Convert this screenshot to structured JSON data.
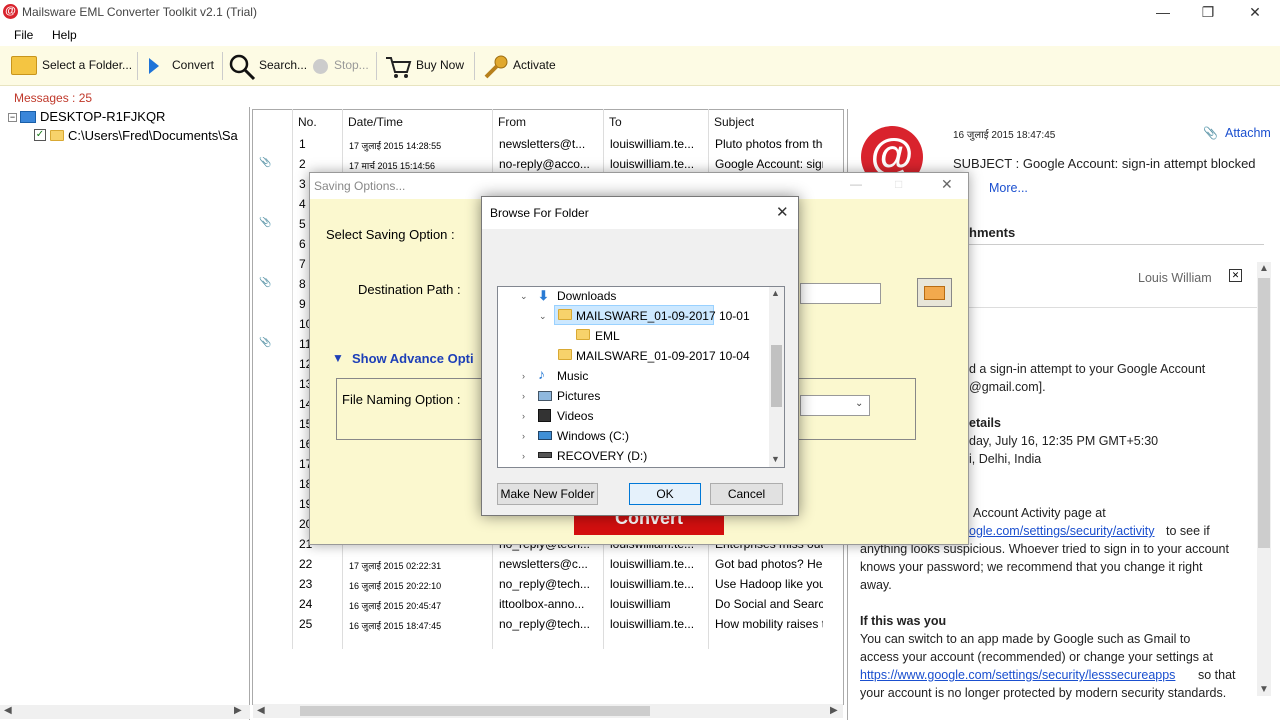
{
  "window": {
    "title": "Mailsware EML Converter Toolkit v2.1 (Trial)",
    "minimize": "—",
    "maximize": "❐",
    "close": "✕"
  },
  "menu": [
    "File",
    "Help"
  ],
  "toolbar": {
    "select_folder": "Select a Folder...",
    "convert": "Convert",
    "search": "Search...",
    "stop": "Stop...",
    "buy_now": "Buy Now",
    "activate": "Activate"
  },
  "messages_label": "Messages : 25",
  "tree": {
    "root": "DESKTOP-R1FJKQR",
    "child": "C:\\Users\\Fred\\Documents\\Sa"
  },
  "grid": {
    "headers": [
      "No.",
      "Date/Time",
      "From",
      "To",
      "Subject"
    ],
    "rows": [
      {
        "no": "1",
        "date": "17 जुलाई 2015 14:28:55",
        "from": "newsletters@t...",
        "to": "louiswilliam.te...",
        "subject": "Pluto photos from the",
        "att": false
      },
      {
        "no": "2",
        "date": "17 मार्च 2015 15:14:56",
        "from": "no-reply@acco...",
        "to": "louiswilliam.te...",
        "subject": "Google Account: sign-i",
        "att": true
      },
      {
        "no": "3",
        "att": false
      },
      {
        "no": "4",
        "att": false
      },
      {
        "no": "5",
        "att": true
      },
      {
        "no": "6",
        "att": false
      },
      {
        "no": "7",
        "att": false
      },
      {
        "no": "8",
        "att": true
      },
      {
        "no": "9",
        "att": false
      },
      {
        "no": "10",
        "att": false
      },
      {
        "no": "11",
        "att": true
      },
      {
        "no": "12",
        "att": false
      },
      {
        "no": "13",
        "att": false
      },
      {
        "no": "14",
        "att": false
      },
      {
        "no": "15",
        "att": false
      },
      {
        "no": "16",
        "att": false
      },
      {
        "no": "17",
        "att": false
      },
      {
        "no": "18",
        "att": false
      },
      {
        "no": "19",
        "att": false
      },
      {
        "no": "20",
        "att": false
      },
      {
        "no": "21",
        "from": "no_reply@tech...",
        "to": "louiswilliam.te...",
        "subject": "Enterprises miss out o",
        "att": false
      },
      {
        "no": "22",
        "date": "17 जुलाई 2015 02:22:31",
        "from": "newsletters@c...",
        "to": "louiswilliam.te...",
        "subject": "Got bad photos? Here",
        "att": false
      },
      {
        "no": "23",
        "date": "16 जुलाई 2015 20:22:10",
        "from": "no_reply@tech...",
        "to": "louiswilliam.te...",
        "subject": "Use Hadoop like your c",
        "att": false
      },
      {
        "no": "24",
        "date": "16 जुलाई 2015 20:45:47",
        "from": "ittoolbox-anno...",
        "to": "louiswilliam",
        "subject": "Do Social and Search a",
        "att": false
      },
      {
        "no": "25",
        "date": "16 जुलाई 2015 18:47:45",
        "from": "no_reply@tech...",
        "to": "louiswilliam.te...",
        "subject": "How mobility raises the",
        "att": false
      }
    ]
  },
  "preview": {
    "date": "16 जुलाई 2015 18:47:45",
    "attachments_link": "Attachm",
    "subject": "SUBJECT : Google Account: sign-in attempt blocked",
    "more": "More...",
    "attachments_tab": "hments",
    "sender": "Louis William",
    "lines": [
      "d a sign-in attempt to your Google Account",
      "@gmail.com].",
      "etails",
      "day, July 16, 12:35 PM GMT+5:30",
      "i, Delhi, India",
      "Account Activity page at",
      "anything looks suspicious. Whoever tried to sign in to your account",
      "knows your password; we recommend that you change it right",
      "away.",
      "If this was you",
      "You can switch to an app made by Google such as Gmail to",
      "access your account (recommended) or change your settings at",
      "so that",
      "your account is no longer protected by modern security standards."
    ],
    "link1": "ogle.com/settings/security/activity",
    "link1_tail": "to see if",
    "link2": "https://www.google.com/settings/security/lesssecureapps"
  },
  "saving": {
    "title": "Saving Options...",
    "select_option": "Select Saving Option :",
    "destination": "Destination Path :",
    "advance": "Show Advance Opti",
    "file_naming": "File Naming Option :",
    "convert": "Convert"
  },
  "browse": {
    "title": "Browse For Folder",
    "close": "✕",
    "items": {
      "downloads": "Downloads",
      "mailsware1": "MAILSWARE_01-09-2017 10-01",
      "eml": "EML",
      "mailsware2": "MAILSWARE_01-09-2017 10-04",
      "music": "Music",
      "pictures": "Pictures",
      "videos": "Videos",
      "windows": "Windows (C:)",
      "recovery": "RECOVERY (D:)"
    },
    "make_new_folder": "Make New Folder",
    "ok": "OK",
    "cancel": "Cancel"
  }
}
